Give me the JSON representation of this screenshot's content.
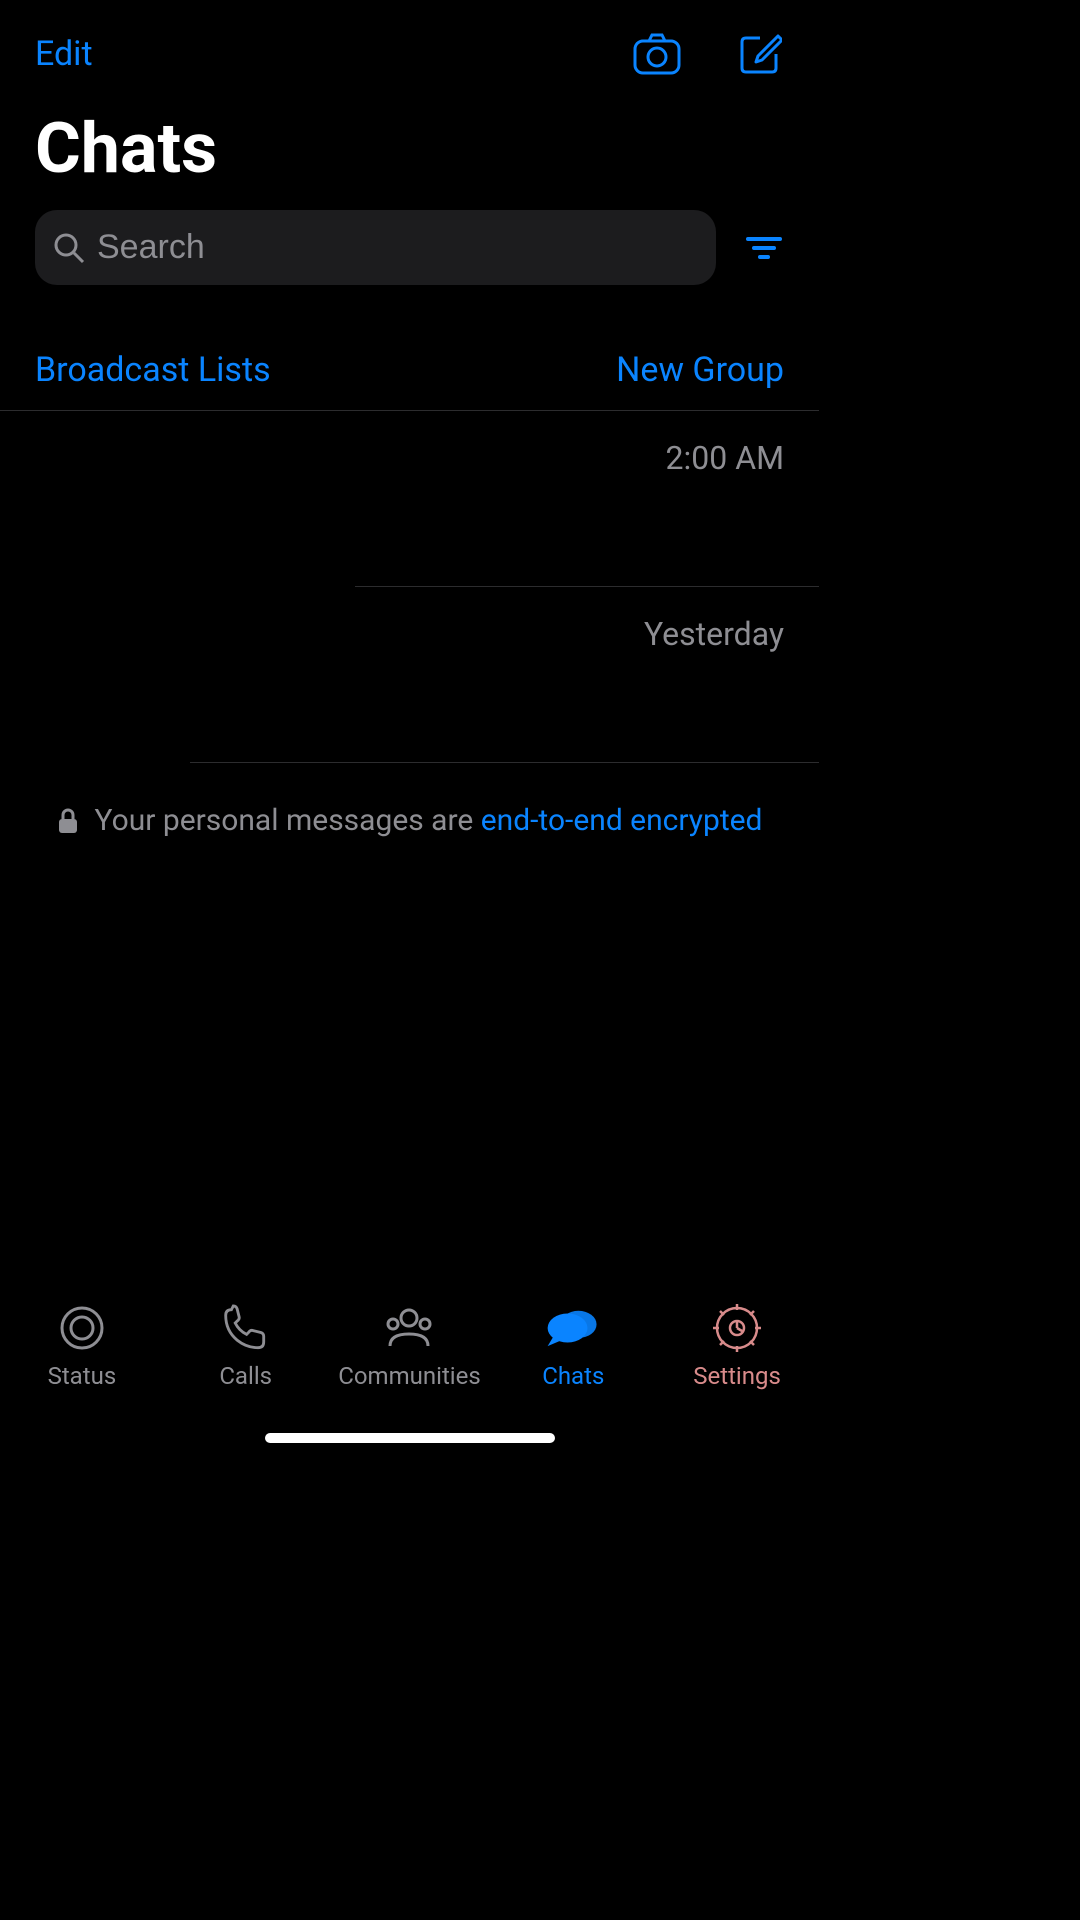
{
  "header": {
    "edit_label": "Edit",
    "page_title": "Chats"
  },
  "search": {
    "placeholder": "Search"
  },
  "links": {
    "broadcast_label": "Broadcast Lists",
    "new_group_label": "New Group"
  },
  "chats": [
    {
      "time": "2:00 AM"
    },
    {
      "time": "Yesterday"
    }
  ],
  "encryption": {
    "prefix_text": "Your personal messages are ",
    "link_text": "end-to-end encrypted"
  },
  "tabs": {
    "status": "Status",
    "calls": "Calls",
    "communities": "Communities",
    "chats": "Chats",
    "settings": "Settings"
  },
  "colors": {
    "accent": "#0a84ff",
    "highlight_bg": "#b93333"
  }
}
